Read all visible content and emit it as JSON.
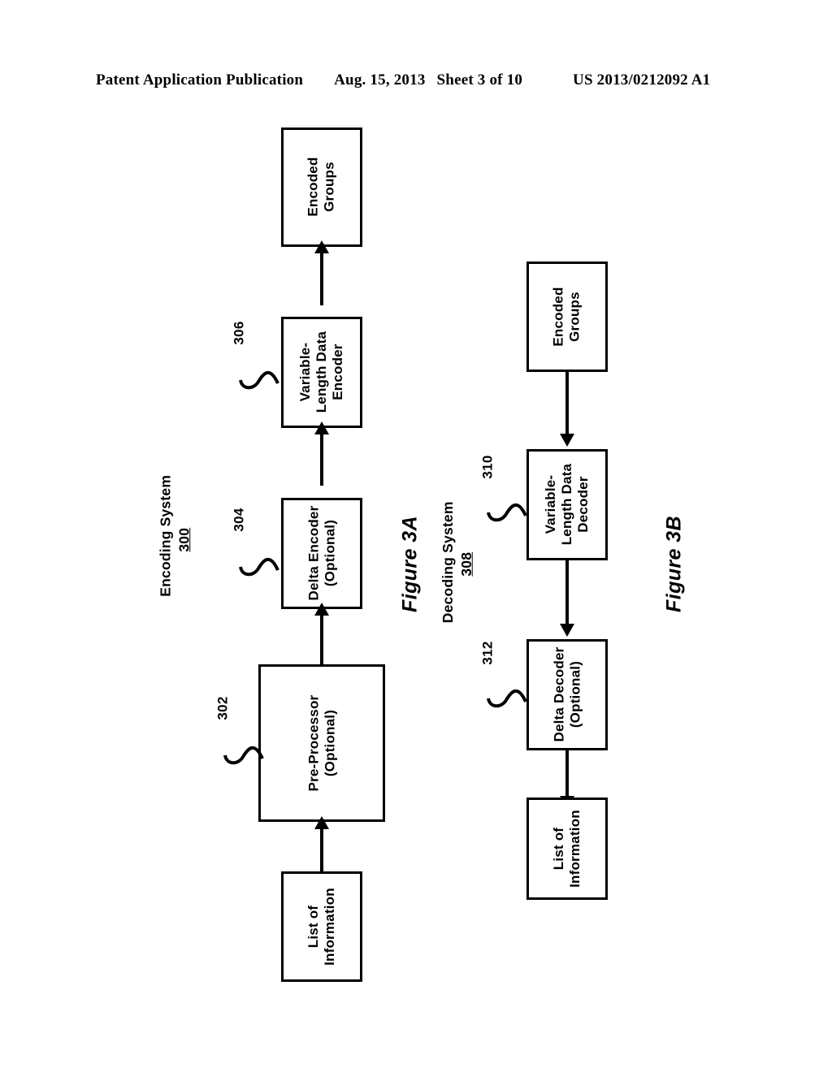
{
  "header": {
    "publication": "Patent Application Publication",
    "date": "Aug. 15, 2013",
    "sheet": "Sheet 3 of 10",
    "patent_number": "US 2013/0212092 A1"
  },
  "figures": [
    {
      "caption": "Figure 3A",
      "system_title": "Encoding System",
      "system_number": "300",
      "flow_direction": "bottom-to-top",
      "blocks": [
        {
          "id": "encoded-groups-a",
          "label": "Encoded\nGroups",
          "ref": null
        },
        {
          "id": "variable-length-data-encoder",
          "label": "Variable-\nLength Data\nEncoder",
          "ref": "306"
        },
        {
          "id": "delta-encoder",
          "label": "Delta Encoder\n(Optional)",
          "ref": "304"
        },
        {
          "id": "pre-processor",
          "label": "Pre-Processor\n(Optional)",
          "ref": "302"
        },
        {
          "id": "list-of-information-a",
          "label": "List of\nInformation",
          "ref": null
        }
      ]
    },
    {
      "caption": "Figure 3B",
      "system_title": "Decoding System",
      "system_number": "308",
      "flow_direction": "top-to-bottom",
      "blocks": [
        {
          "id": "encoded-groups-b",
          "label": "Encoded\nGroups",
          "ref": null
        },
        {
          "id": "variable-length-data-decoder",
          "label": "Variable-\nLength Data\nDecoder",
          "ref": "310"
        },
        {
          "id": "delta-decoder",
          "label": "Delta Decoder\n(Optional)",
          "ref": "312"
        },
        {
          "id": "list-of-information-b",
          "label": "List of\nInformation",
          "ref": null
        }
      ]
    }
  ],
  "colors": {
    "ink": "#000000",
    "paper": "#ffffff"
  }
}
